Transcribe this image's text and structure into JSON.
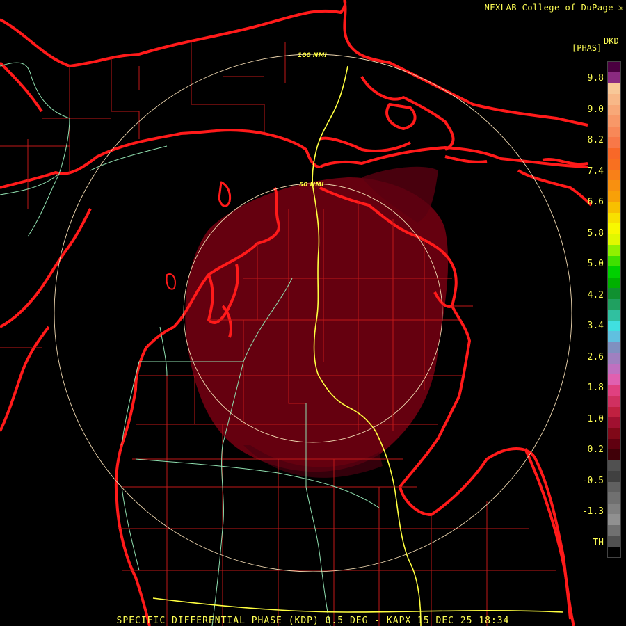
{
  "header": {
    "credit": "NEXLAB-College of DuPage",
    "icon": "resize-corner-icon"
  },
  "colorbar": {
    "product_code": "DKD",
    "units": "[PHAS]",
    "labels": [
      "9.8",
      "9.0",
      "8.2",
      "7.4",
      "6.6",
      "5.8",
      "5.0",
      "4.2",
      "3.4",
      "2.6",
      "1.8",
      "1.0",
      "0.2",
      "-0.5",
      "-1.3",
      "TH"
    ],
    "colors": [
      "#4a0040",
      "#8a2a80",
      "#f8c898",
      "#f8b888",
      "#f8a878",
      "#f89868",
      "#f88858",
      "#f87848",
      "#f86828",
      "#f87020",
      "#f88018",
      "#f89010",
      "#f8a008",
      "#f8c000",
      "#f8e000",
      "#f8f800",
      "#e0f800",
      "#90f000",
      "#40e000",
      "#00d000",
      "#00b000",
      "#109030",
      "#20a060",
      "#30c0a0",
      "#40e0e0",
      "#60c0e0",
      "#8090c0",
      "#a080c0",
      "#c070c0",
      "#e060b0",
      "#e04080",
      "#d03060",
      "#c02040",
      "#a01030",
      "#800818",
      "#600010",
      "#400008",
      "#505050",
      "#404040",
      "#606060",
      "#707070",
      "#808080",
      "#909090",
      "#707070",
      "#505050",
      "#000000"
    ]
  },
  "rings": [
    {
      "label": "100 NMI",
      "range_nmi": 100
    },
    {
      "label": "50 NMI",
      "range_nmi": 50
    }
  ],
  "footer": {
    "caption": "SPECIFIC DIFFERENTIAL PHASE (KDP) 0.5 DEG - KAPX 15 DEC 25 18:34"
  },
  "colors": {
    "coastline": "#ff1a1a",
    "county": "#c01818",
    "highway_major": "#ffff40",
    "highway_minor": "#90e0b0",
    "ring": "#f0d8b0",
    "echo": "#6a0010"
  }
}
